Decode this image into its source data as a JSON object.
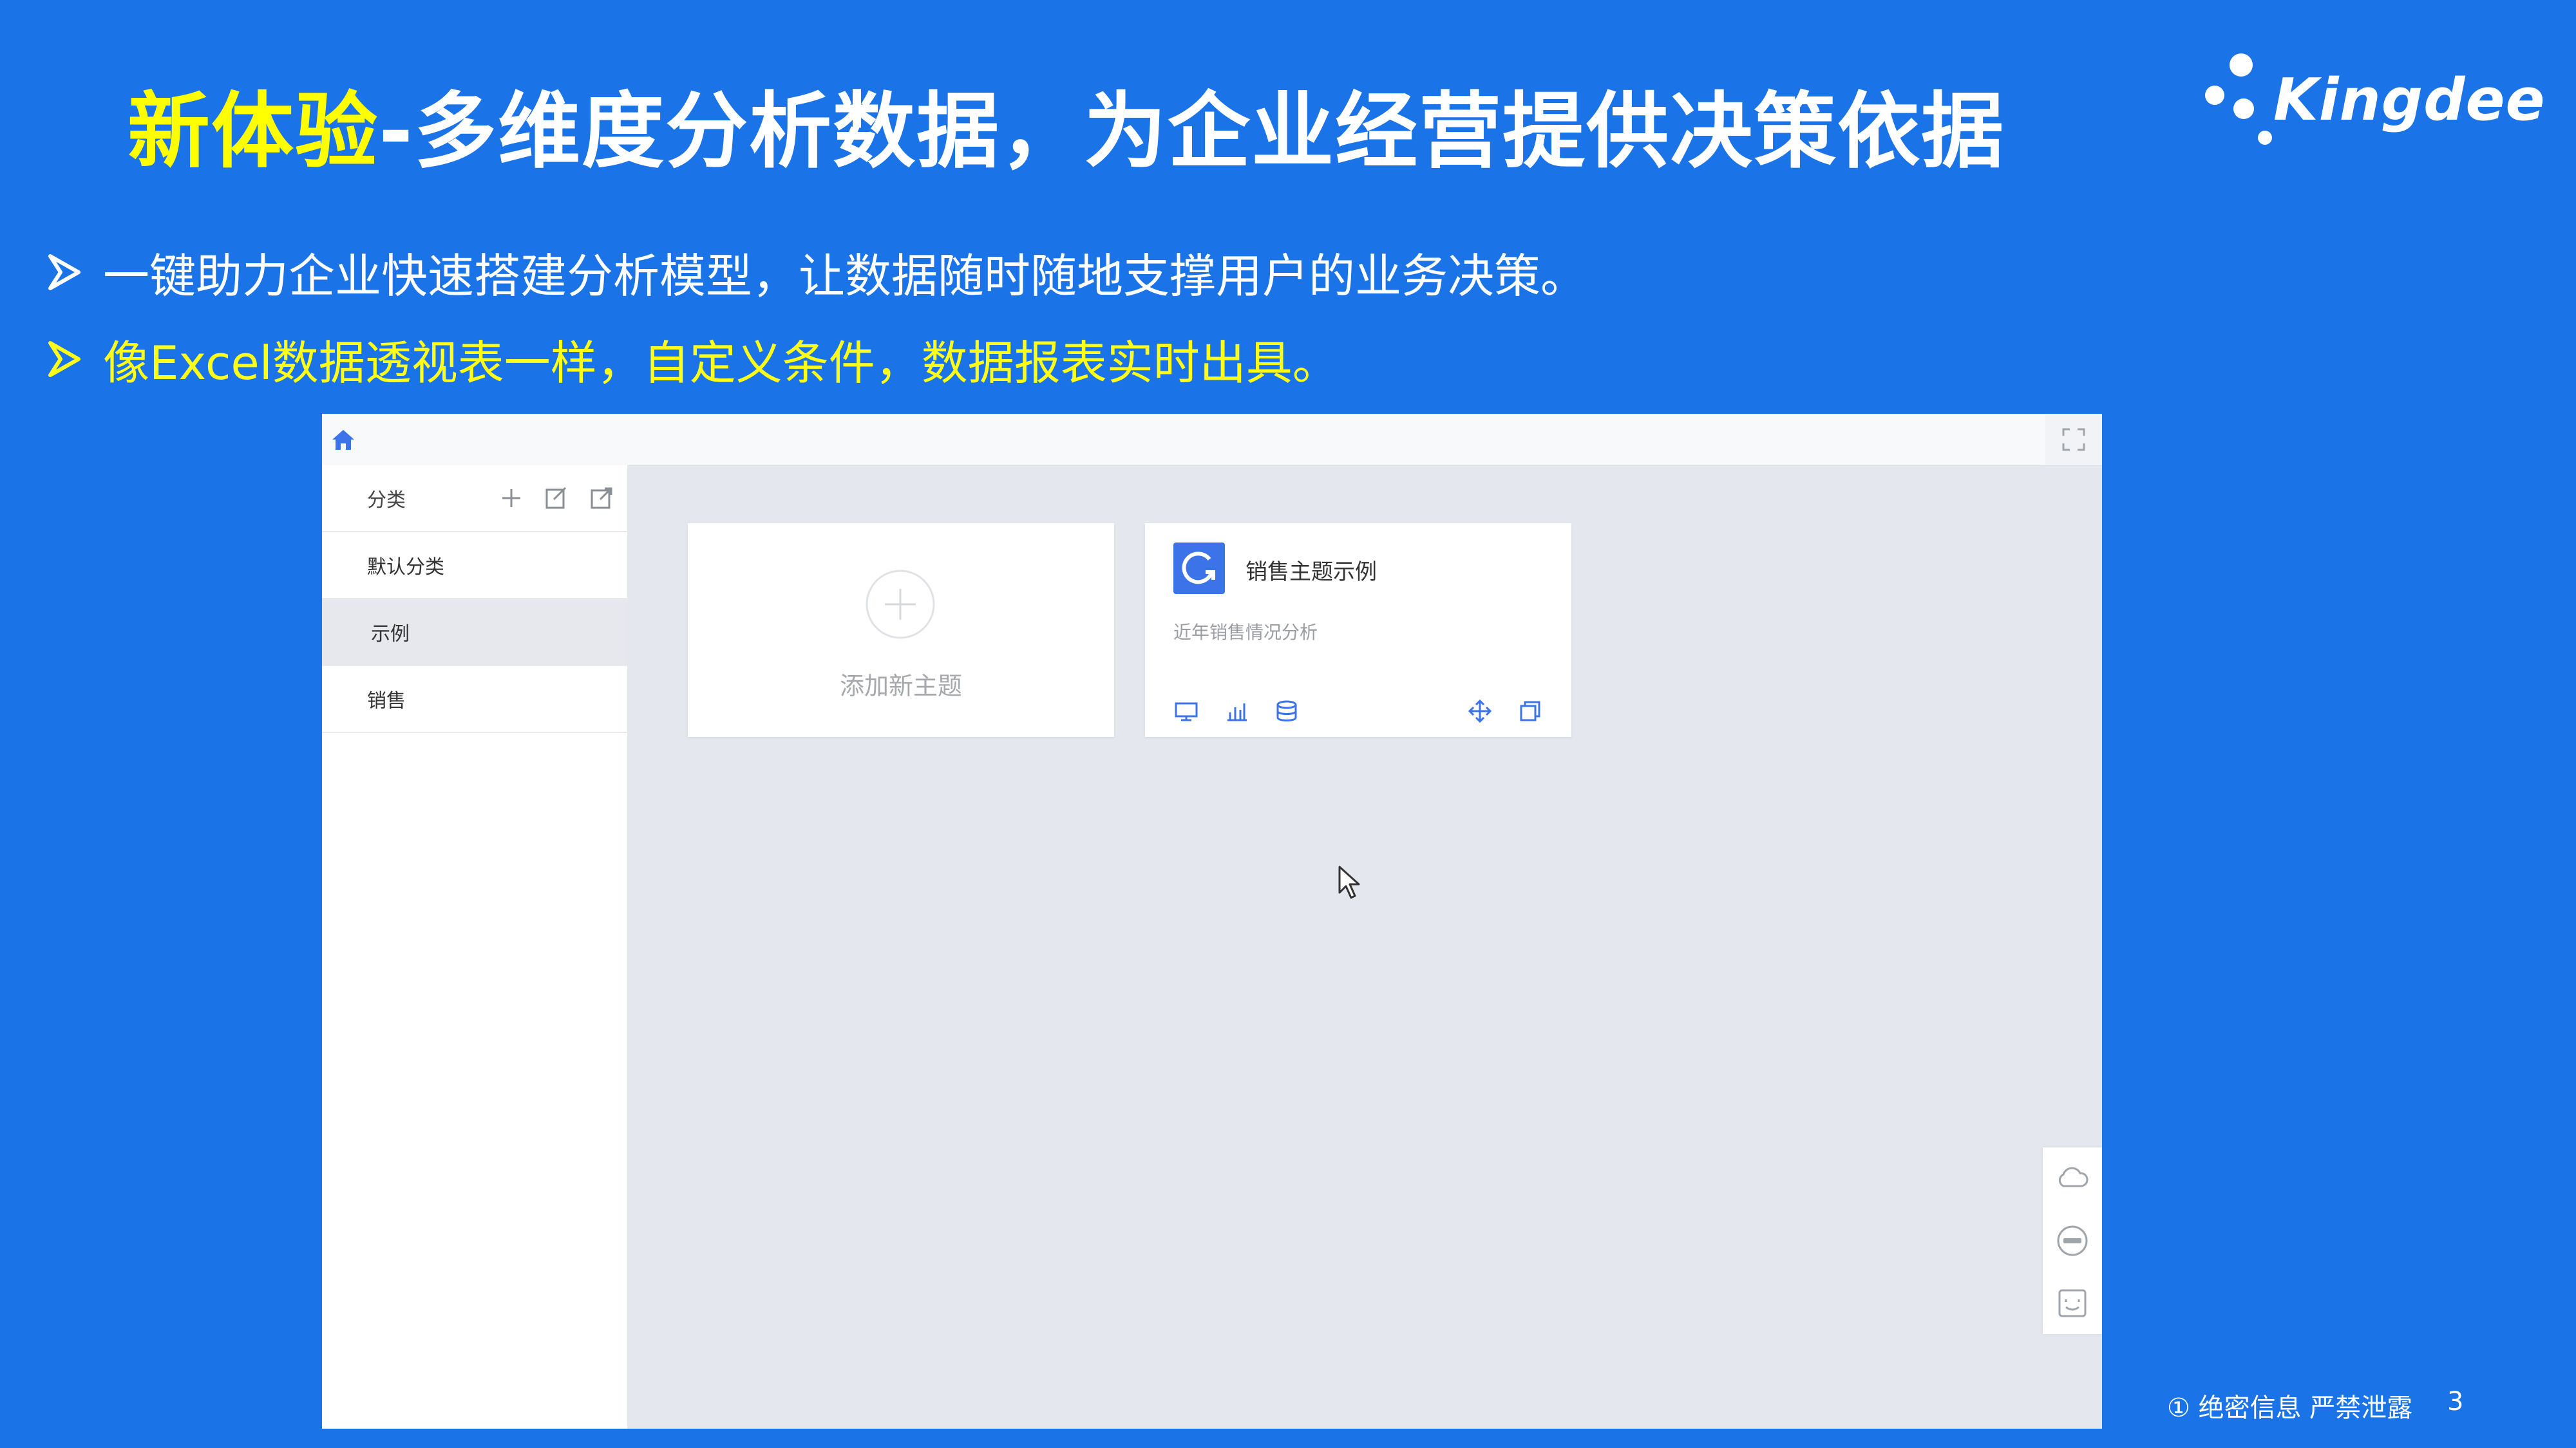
{
  "slide": {
    "title_highlight": "新体验",
    "title_rest": "-多维度分析数据，为企业经营提供决策依据",
    "logo_text": "Kingdee",
    "bullets": [
      "一键助力企业快速搭建分析模型，让数据随时随地支撑用户的业务决策。",
      "像Excel数据透视表一样，自定义条件，数据报表实时出具。"
    ],
    "footer_note": "① 绝密信息 严禁泄露",
    "page_number": "3",
    "colors": {
      "background": "#1b73e8",
      "highlight": "#ffff00",
      "accent": "#3c73e8"
    }
  },
  "app": {
    "sidebar": {
      "header_label": "分类",
      "items": [
        {
          "label": "默认分类"
        },
        {
          "label": "示例",
          "active": true
        },
        {
          "label": "销售"
        }
      ]
    },
    "cards": {
      "add_label": "添加新主题",
      "topic": {
        "title": "销售主题示例",
        "description": "近年销售情况分析"
      }
    },
    "icons": [
      "home-icon",
      "fullscreen-icon",
      "add-icon",
      "edit-icon",
      "export-icon",
      "refresh-icon",
      "monitor-icon",
      "bar-chart-icon",
      "database-icon",
      "move-icon",
      "copy-icon",
      "cloud-icon",
      "minus-circle-icon",
      "feedback-icon",
      "cursor-icon"
    ]
  }
}
